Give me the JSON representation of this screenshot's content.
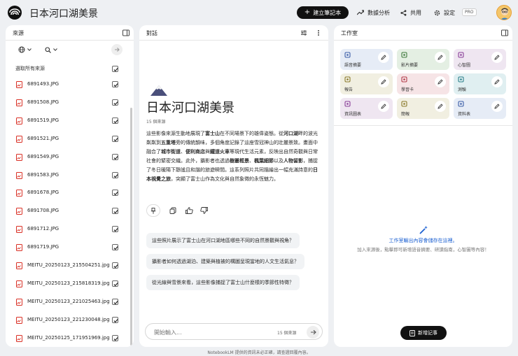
{
  "header": {
    "title": "日本河口湖美景",
    "new_notebook_label": "建立筆記本",
    "analytics_label": "數據分析",
    "share_label": "共用",
    "settings_label": "設定",
    "pro_badge": "PRO"
  },
  "sources": {
    "panel_title": "來源",
    "select_all_label": "選取所有來源",
    "items": [
      {
        "name": "6891493.JPG"
      },
      {
        "name": "6891508.JPG"
      },
      {
        "name": "6891519.JPG"
      },
      {
        "name": "6891521.JPG"
      },
      {
        "name": "6891549.JPG"
      },
      {
        "name": "6891583.JPG"
      },
      {
        "name": "6891678.JPG"
      },
      {
        "name": "6891708.JPG"
      },
      {
        "name": "6891712.JPG"
      },
      {
        "name": "6891719.JPG"
      },
      {
        "name": "MEITU_20250123_215504251.jpg"
      },
      {
        "name": "MEITU_20250123_215818319.jpg"
      },
      {
        "name": "MEITU_20250123_221025463.jpg"
      },
      {
        "name": "MEITU_20250123_221230048.jpg"
      },
      {
        "name": "MEITU_20250125_171951969.jpg"
      }
    ]
  },
  "chat": {
    "panel_title": "對話",
    "doc_title": "日本河口湖美景",
    "source_count": "15 個來源",
    "summary_parts": [
      {
        "t": "這些影像來源生動地展現了",
        "b": false
      },
      {
        "t": "富士山",
        "b": true
      },
      {
        "t": "在不同場景下的雄偉姿態。從",
        "b": false
      },
      {
        "t": "河口湖",
        "b": true
      },
      {
        "t": "畔的波光粼粼到",
        "b": false
      },
      {
        "t": "五重塔",
        "b": true
      },
      {
        "t": "旁的傳統韻味，多個角度記錄了這座雪冠神山的壯麗景致。畫面中融合了",
        "b": false
      },
      {
        "t": "城市街道",
        "b": true
      },
      {
        "t": "、",
        "b": false
      },
      {
        "t": "便利商店",
        "b": true
      },
      {
        "t": "與",
        "b": false
      },
      {
        "t": "鐵道火車",
        "b": true
      },
      {
        "t": "等現代生活元素，反映出自然奇觀與日常社會的緊密交織。此外，攝影者也透過",
        "b": false
      },
      {
        "t": "樹叢框景",
        "b": true
      },
      {
        "t": "、",
        "b": false
      },
      {
        "t": "楓葉細節",
        "b": true
      },
      {
        "t": "以及",
        "b": false
      },
      {
        "t": "人物留影",
        "b": true
      },
      {
        "t": "，捕捉了冬日暖陽下靜謐且和諧的旅遊瞬間。這系列照片共同描繪出一幅充滿詩意的",
        "b": false
      },
      {
        "t": "日本視覺之旅",
        "b": true
      },
      {
        "t": "，突顯了富士山作為文化與自然象徵的永恆魅力。",
        "b": false
      }
    ],
    "questions": [
      "這些照片展示了富士山在河口湖地區哪些不同的自然景觀與視角？",
      "攝影者如何透過湖泊、建築與植被的構圖呈現當地的人文生活氣息？",
      "從光線與雪景來看，這些影像捕捉了富士山什麼樣的季節性特徵？"
    ],
    "input_placeholder": "開始輸入...",
    "input_source_count": "15 個來源"
  },
  "studio": {
    "panel_title": "工作室",
    "tiles": [
      {
        "label": "語音摘要",
        "icon": "audio-icon",
        "bg": "#e6ecf6",
        "color": "#3d5fa8"
      },
      {
        "label": "影片摘要",
        "icon": "video-icon",
        "bg": "#e4efe3",
        "color": "#3f7a3d"
      },
      {
        "label": "心智圖",
        "icon": "mindmap-icon",
        "bg": "#efe6f1",
        "color": "#8a3f99"
      },
      {
        "label": "報告",
        "icon": "report-icon",
        "bg": "#f1efe1",
        "color": "#8a7a2a"
      },
      {
        "label": "學習卡",
        "icon": "flashcard-icon",
        "bg": "#f6e4e6",
        "color": "#b23a48"
      },
      {
        "label": "測驗",
        "icon": "quiz-icon",
        "bg": "#e0eff1",
        "color": "#2a7f8a"
      },
      {
        "label": "資訊圖表",
        "icon": "infographic-icon",
        "bg": "#efe6f1",
        "color": "#8a3f99"
      },
      {
        "label": "簡報",
        "icon": "slides-icon",
        "bg": "#f1efe1",
        "color": "#8a7a2a"
      },
      {
        "label": "資料表",
        "icon": "table-icon",
        "bg": "#e6ecf6",
        "color": "#3d5fa8"
      }
    ],
    "empty_title": "工作室輸出內容會儲存在這裡。",
    "empty_sub": "加入來源後，點擊即可新增語音摘要、研讀指南，心智圖等內容！",
    "add_note_label": "新增記事"
  },
  "footer": {
    "disclaimer": "NotebookLM 提供的資訊未必正確，請查證回覆內容。"
  }
}
